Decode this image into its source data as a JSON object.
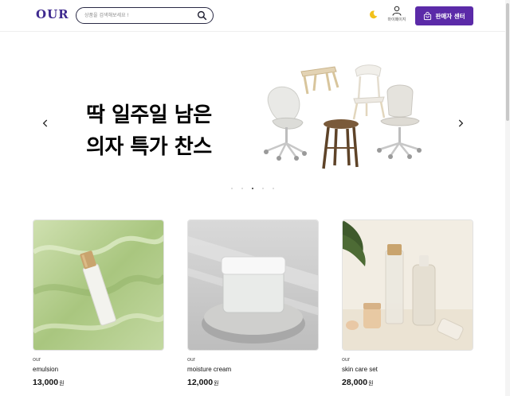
{
  "header": {
    "logo": "OUR",
    "search_placeholder": "상품을 검색해보세요 !",
    "mypage_label": "마이페이지",
    "seller_center_label": "판매자 센터"
  },
  "hero": {
    "title_line1": "딱 일주일 남은",
    "title_line2": "의자 특가 찬스",
    "slide_count": 5,
    "active_slide": 3
  },
  "products": [
    {
      "brand": "our",
      "name": "emulsion",
      "price": "13,000",
      "currency": "원"
    },
    {
      "brand": "our",
      "name": "moisture cream",
      "price": "12,000",
      "currency": "원"
    },
    {
      "brand": "our",
      "name": "skin care set",
      "price": "28,000",
      "currency": "원"
    }
  ],
  "colors": {
    "brand_purple": "#5b2aa8",
    "logo_purple": "#3f2a8f",
    "moon_yellow": "#f2c11b"
  },
  "icons": {
    "search": "search-icon",
    "theme": "moon-icon",
    "user": "user-icon",
    "shop": "shopping-bag-icon",
    "prev": "chevron-left-icon",
    "next": "chevron-right-icon"
  }
}
